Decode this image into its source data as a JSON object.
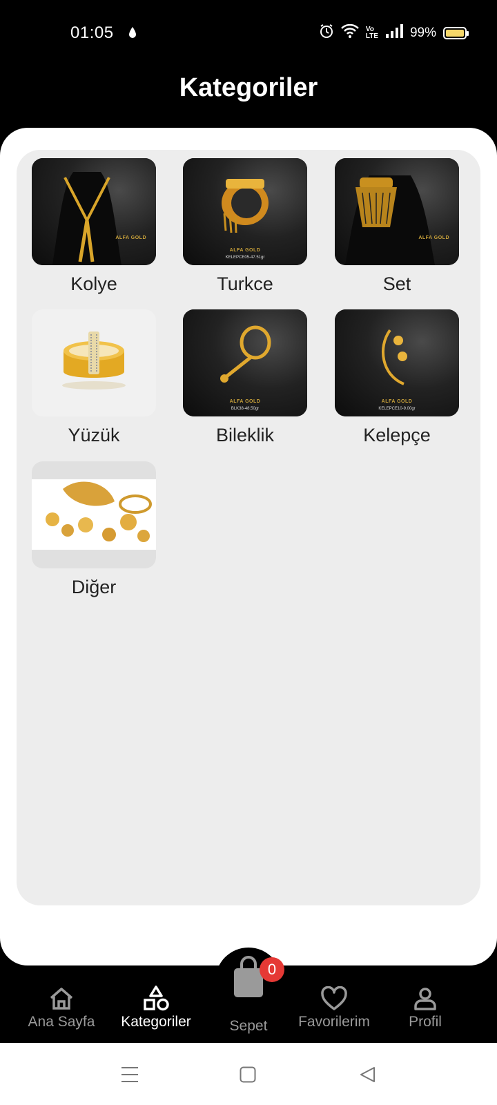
{
  "status": {
    "time": "01:05",
    "battery": "99%",
    "lte_top": "Vo",
    "lte_bottom": "LTE"
  },
  "header": {
    "title": "Kategoriler"
  },
  "categories": [
    {
      "label": "Kolye"
    },
    {
      "label": "Turkce",
      "brand": "ALFA GOLD",
      "code": "KELEPCE05-47.51gr"
    },
    {
      "label": "Set",
      "brand": "ALFA GOLD"
    },
    {
      "label": "Yüzük"
    },
    {
      "label": "Bileklik",
      "brand": "ALFA GOLD",
      "code": "BLK38-48.50gr"
    },
    {
      "label": "Kelepçe",
      "brand": "ALFA GOLD",
      "code": "KELEPCE10-9.00gr"
    },
    {
      "label": "Diğer"
    }
  ],
  "brand_first": "ALFA GOLD",
  "nav": {
    "home": "Ana Sayfa",
    "categories": "Kategoriler",
    "cart": "Sepet",
    "cart_count": "0",
    "favorites": "Favorilerim",
    "profile": "Profil"
  },
  "colors": {
    "accent": "#000000",
    "badge": "#e53935",
    "gold": "#c9a23b"
  }
}
